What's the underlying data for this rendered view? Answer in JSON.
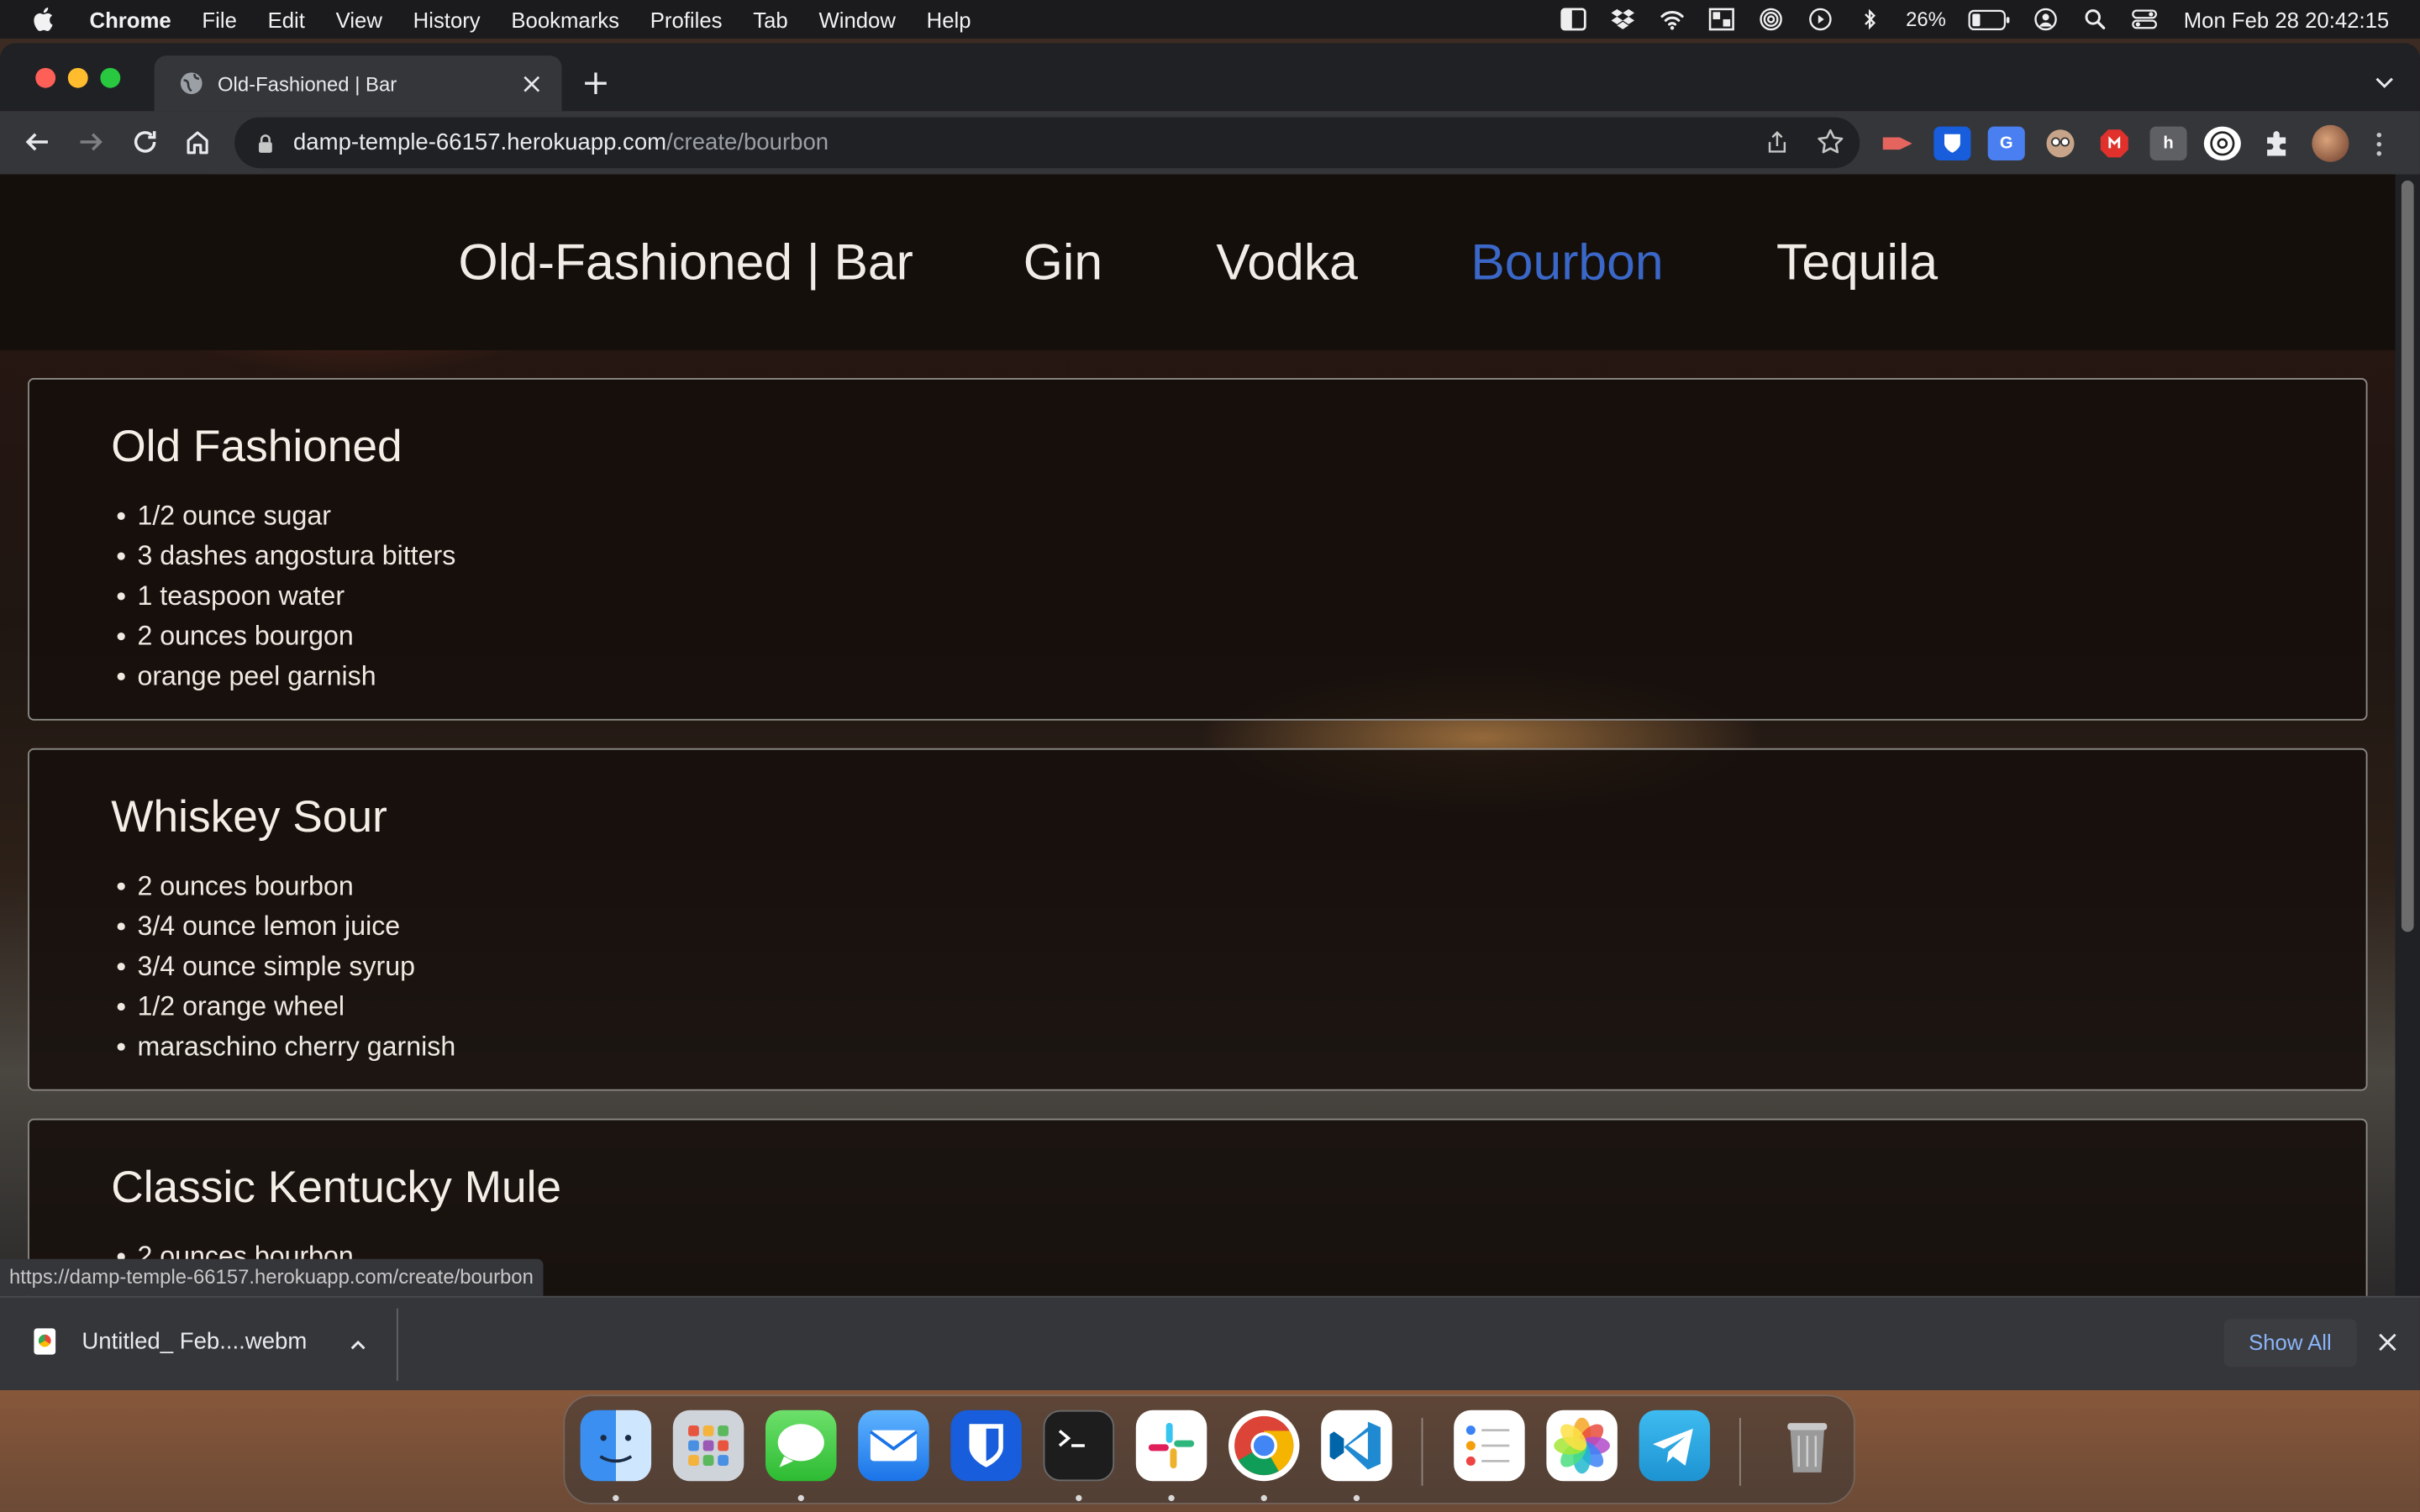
{
  "menubar": {
    "app_name": "Chrome",
    "items": [
      "File",
      "Edit",
      "View",
      "History",
      "Bookmarks",
      "Profiles",
      "Tab",
      "Window",
      "Help"
    ],
    "battery_percent": "26%",
    "datetime": "Mon Feb 28  20:42:15"
  },
  "browser": {
    "tab_title": "Old-Fashioned | Bar",
    "url_host": "damp-temple-66157.herokuapp.com",
    "url_path": "/create/bourbon",
    "status_url": "https://damp-temple-66157.herokuapp.com/create/bourbon"
  },
  "page": {
    "nav": {
      "brand": "Old-Fashioned | Bar",
      "links": [
        "Gin",
        "Vodka",
        "Bourbon",
        "Tequila"
      ],
      "active": "Bourbon",
      "active_color": "#3a67c8"
    },
    "recipes": [
      {
        "name": "Old Fashioned",
        "ingredients": [
          "1/2 ounce sugar",
          "3 dashes angostura bitters",
          "1 teaspoon water",
          "2 ounces bourgon",
          "orange peel garnish"
        ]
      },
      {
        "name": "Whiskey Sour",
        "ingredients": [
          "2 ounces bourbon",
          "3/4 ounce lemon juice",
          "3/4 ounce simple syrup",
          "1/2 orange wheel",
          "maraschino cherry garnish"
        ]
      },
      {
        "name": "Classic Kentucky Mule",
        "ingredients": [
          "2 ounces bourbon"
        ]
      }
    ]
  },
  "downloads": {
    "file_name": "Untitled_ Feb....webm",
    "show_all_label": "Show All"
  },
  "dock": {
    "apps": [
      "finder-icon",
      "launchpad-icon",
      "messages-icon",
      "mail-icon",
      "bitwarden-icon",
      "terminal-icon",
      "slack-icon",
      "chrome-icon",
      "vscode-icon",
      "reminders-icon",
      "photos-icon",
      "telegram-icon",
      "trash-icon"
    ]
  }
}
